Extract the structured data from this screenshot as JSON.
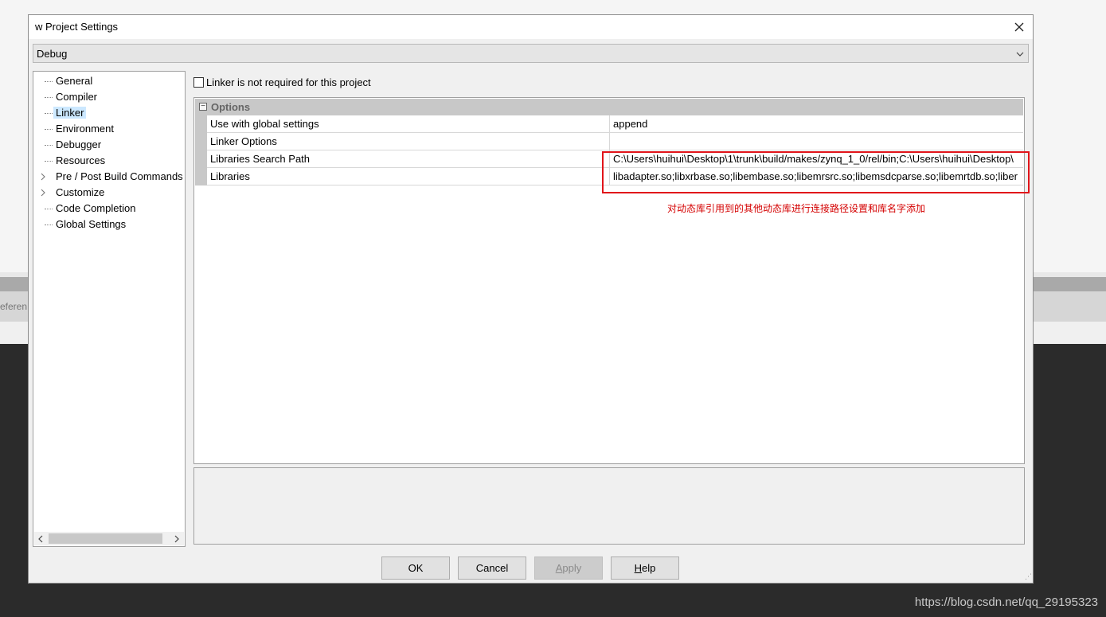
{
  "background": {
    "left_fragment": "eferen",
    "watermark": "https://blog.csdn.net/qq_29195323"
  },
  "dialog": {
    "title": "w Project Settings",
    "close_icon": "close-icon",
    "configuration": "Debug"
  },
  "tree": {
    "items": [
      {
        "label": "General",
        "expandable": false
      },
      {
        "label": "Compiler",
        "expandable": false
      },
      {
        "label": "Linker",
        "expandable": false,
        "selected": true
      },
      {
        "label": "Environment",
        "expandable": false
      },
      {
        "label": "Debugger",
        "expandable": false
      },
      {
        "label": "Resources",
        "expandable": false
      },
      {
        "label": "Pre / Post Build Commands",
        "expandable": true
      },
      {
        "label": "Customize",
        "expandable": true
      },
      {
        "label": "Code Completion",
        "expandable": false
      },
      {
        "label": "Global Settings",
        "expandable": false
      }
    ]
  },
  "linker_not_required": {
    "label": "Linker is not required for this project",
    "checked": false
  },
  "grid": {
    "section": "Options",
    "rows": [
      {
        "name": "Use with global settings",
        "value": "append"
      },
      {
        "name": "Linker Options",
        "value": ""
      },
      {
        "name": "Libraries Search Path",
        "value": "C:\\Users\\huihui\\Desktop\\1\\trunk\\build/makes/zynq_1_0/rel/bin;C:\\Users\\huihui\\Desktop\\"
      },
      {
        "name": "Libraries",
        "value": "libadapter.so;libxrbase.so;libembase.so;libemrsrc.so;libemsdcparse.so;libemrtdb.so;liber"
      }
    ]
  },
  "annotation": "对动态库引用到的其他动态库进行连接路径设置和库名字添加",
  "buttons": {
    "ok": "OK",
    "cancel": "Cancel",
    "apply": "Apply",
    "help": "Help"
  }
}
